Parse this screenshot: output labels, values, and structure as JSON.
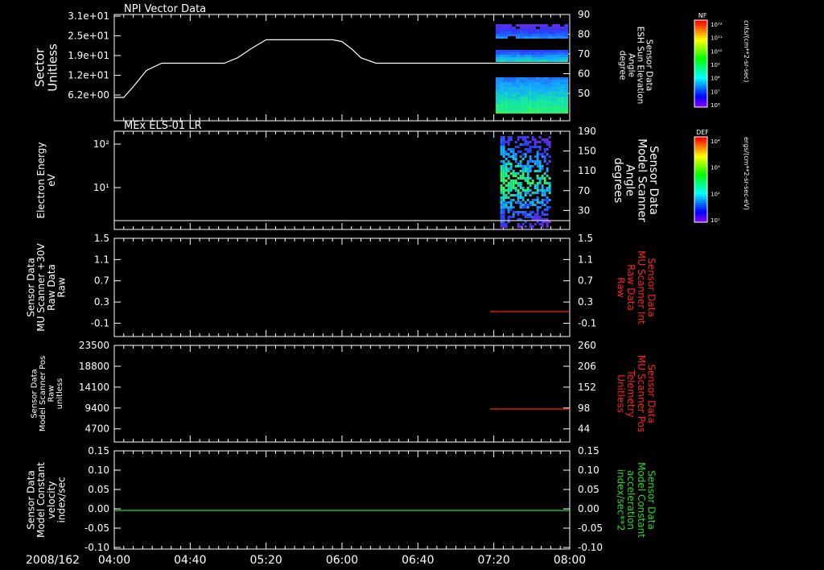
{
  "date_label": "2008/162",
  "time_ticks": [
    "04:00",
    "04:40",
    "05:20",
    "06:00",
    "06:40",
    "07:20",
    "08:00"
  ],
  "colors": {
    "axis": "#ffffff",
    "background": "#000000",
    "red_series": "#ff2020",
    "green_series": "#22dd22"
  },
  "colorbars": [
    {
      "title": "NF",
      "unit": "cnts/(cm**2-sr-sec)",
      "ticks": [
        "10¹²",
        "10¹¹",
        "10¹⁰",
        "10⁹",
        "10⁸",
        "10⁷",
        "10⁶"
      ]
    },
    {
      "title": "DEF",
      "unit": "ergs/(cm**2-sr-sec-eV)",
      "ticks": [
        "10⁴",
        "10³",
        "10²",
        "10¹"
      ]
    }
  ],
  "chart_data": [
    {
      "type": "line",
      "title": "NPI Vector Data",
      "ylabel": "Sector\nUnitless",
      "yticks": [
        "3.1e+01",
        "2.5e+01",
        "1.9e+01",
        "1.2e+01",
        "6.2e+00"
      ],
      "y2label": "Sensor Data\nESH Sun Elevation\nAngle\ndegree",
      "y2ticks": [
        "90",
        "80",
        "70",
        "60",
        "50"
      ],
      "y2lim": [
        40,
        90
      ],
      "series": [
        {
          "values_x": [
            "04:00",
            "04:05",
            "04:10",
            "04:17",
            "04:25",
            "04:35",
            "04:50",
            "04:58",
            "05:05",
            "05:12",
            "05:20",
            "05:40",
            "05:55",
            "06:00",
            "06:05",
            "06:10",
            "06:18",
            "06:40",
            "07:20",
            "08:00"
          ],
          "values_y": [
            44,
            44,
            50,
            59,
            63,
            63,
            63,
            63,
            66,
            71,
            76,
            76,
            76,
            75,
            71,
            66,
            63,
            63,
            63,
            63
          ]
        }
      ],
      "spectrogram_start": "07:21"
    },
    {
      "type": "heatmap",
      "title": "MEx ELS-01 LR",
      "ylabel": "Electron Energy\neV",
      "yticks": [
        "10²",
        "10¹"
      ],
      "y2label": "Sensor Data\nModel Scanner\nAngle\ndegrees",
      "y2ticks": [
        "190",
        "150",
        "110",
        "70",
        "30"
      ],
      "y2lim": [
        10,
        190
      ],
      "white_line_value": 20,
      "spectrogram_start": "07:20"
    },
    {
      "type": "line",
      "ylabel": "Sensor Data\nMU Scanner +30V\nRaw Data\nRaw",
      "yticks": [
        "1.5",
        "1.1",
        "0.7",
        "0.3",
        "-0.1"
      ],
      "ylim": [
        -0.3,
        1.5
      ],
      "y2label": "Sensor Data\nMU Scanner Int\nRaw Data\nRaw",
      "y2ticks": [
        "1.5",
        "1.1",
        "0.7",
        "0.3",
        "-0.1"
      ],
      "y2lim": [
        -0.3,
        1.5
      ],
      "series": [
        {
          "x_start": "07:18",
          "x_end": "08:00",
          "value": 0.0,
          "color": "red"
        }
      ]
    },
    {
      "type": "line",
      "ylabel": "Sensor Data\nModel Scanner Pos\nRaw\nunitless",
      "yticks": [
        "23500",
        "18800",
        "14100",
        "9400",
        "4700"
      ],
      "ylim": [
        0,
        23500
      ],
      "y2label": "Sensor Data\nMU Scanner Pos\nTelemetry\nUnitless",
      "y2ticks": [
        "260",
        "206",
        "152",
        "98",
        "44"
      ],
      "y2lim": [
        0,
        260
      ],
      "series": [
        {
          "x_start": "07:18",
          "x_end": "08:00",
          "value": 90,
          "color": "red"
        }
      ]
    },
    {
      "type": "line",
      "ylabel": "Sensor Data\nModel Constant\nvelocity\nindex/sec",
      "yticks": [
        "0.15",
        "0.10",
        "0.05",
        "0.00",
        "-0.05",
        "-0.10"
      ],
      "ylim": [
        -0.1,
        0.15
      ],
      "y2label": "Sensor Data\nModel Constant\nacceleration\nindex/sec**2",
      "y2ticks": [
        "0.15",
        "0.10",
        "0.05",
        "0.00",
        "-0.05",
        "-0.10"
      ],
      "y2lim": [
        -0.1,
        0.15
      ],
      "series": [
        {
          "x_start": "04:00",
          "x_end": "08:00",
          "value": 0.0,
          "color": "green"
        }
      ]
    }
  ]
}
